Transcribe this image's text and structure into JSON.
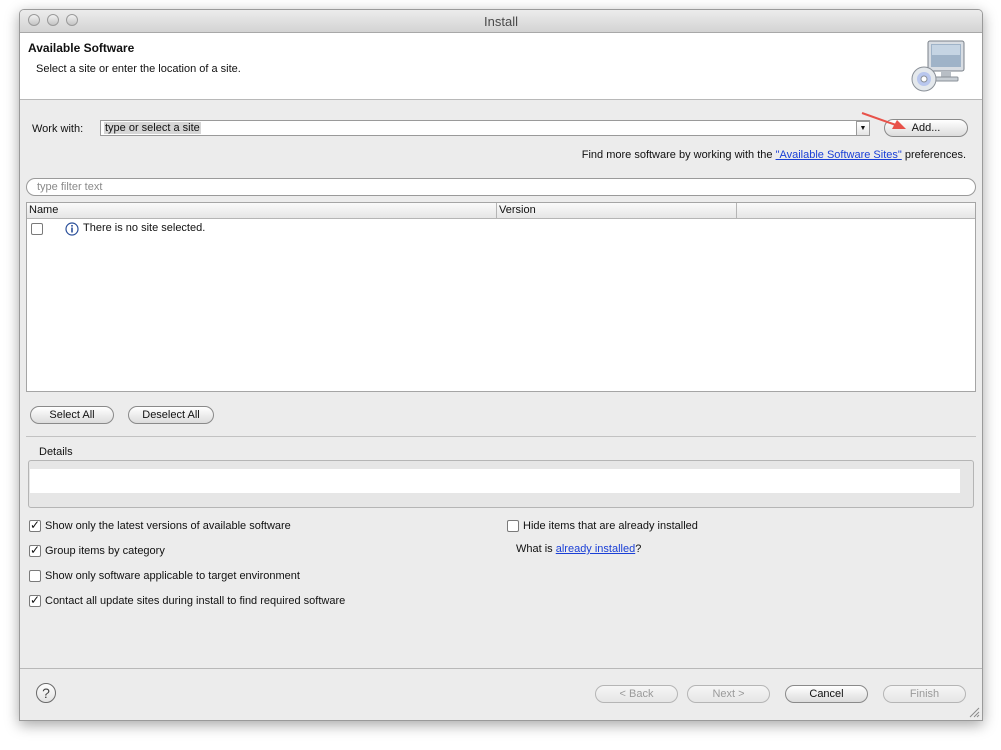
{
  "window": {
    "title": "Install"
  },
  "header": {
    "title": "Available Software",
    "description": "Select a site or enter the location of a site."
  },
  "work_with": {
    "label": "Work with:",
    "value": "type or select a site",
    "add_label": "Add..."
  },
  "find_more": {
    "prefix": "Find more software by working with the ",
    "link": "\"Available Software Sites\"",
    "suffix": " preferences."
  },
  "filter": {
    "placeholder": "type filter text"
  },
  "table": {
    "columns": [
      "Name",
      "Version",
      ""
    ],
    "rows": [
      {
        "name": "There is no site selected.",
        "checked": false
      }
    ]
  },
  "selection": {
    "select_all": "Select All",
    "deselect_all": "Deselect All"
  },
  "details": {
    "label": "Details"
  },
  "options": {
    "latest_versions": {
      "label": "Show only the latest versions of available software",
      "checked": true
    },
    "group_by_category": {
      "label": "Group items by category",
      "checked": true
    },
    "target_env": {
      "label": "Show only software applicable to target environment",
      "checked": false
    },
    "contact_sites": {
      "label": "Contact all update sites during install to find required software",
      "checked": true
    },
    "hide_installed": {
      "label": "Hide items that are already installed",
      "checked": false
    },
    "what_is_prefix": "What is ",
    "what_is_link": "already installed",
    "what_is_suffix": "?"
  },
  "footer": {
    "help": "?",
    "back": "< Back",
    "next": "Next >",
    "cancel": "Cancel",
    "finish": "Finish"
  },
  "colors": {
    "link": "#1a3fd6",
    "annotation_arrow": "#e8524a"
  }
}
